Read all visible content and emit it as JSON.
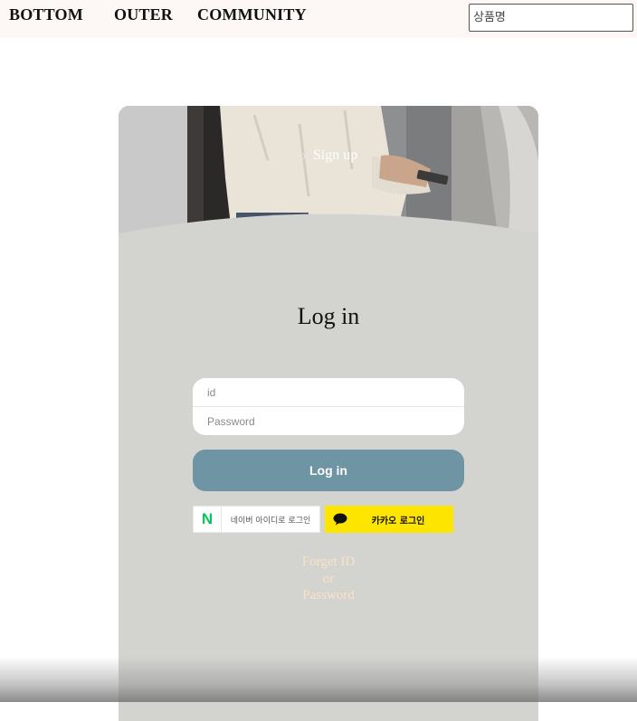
{
  "nav": {
    "items": [
      "BOTTOM",
      "OUTER",
      "COMMUNITY"
    ],
    "search": {
      "placeholder": "상품명",
      "value": ""
    }
  },
  "hero": {
    "or_text": "or",
    "signup_label": "Sign up"
  },
  "login": {
    "title": "Log in",
    "id_placeholder": "id",
    "password_placeholder": "Password",
    "submit_label": "Log in"
  },
  "social": {
    "naver": {
      "logo": "N",
      "label": "네이버 아이디로 로그인",
      "icon": "naver-logo"
    },
    "kakao": {
      "label": "카카오 로그인",
      "icon": "speech-bubble-icon"
    }
  },
  "forget": {
    "line1": "Forget ID",
    "line2": "or",
    "line3": "Password"
  },
  "colors": {
    "nav_bg": "#fdf8f6",
    "card_bg": "#d3d3d0",
    "login_button": "#6f94a4",
    "kakao_yellow": "#fee500",
    "naver_green": "#03c75a",
    "forget_text": "#fbe3c3"
  }
}
